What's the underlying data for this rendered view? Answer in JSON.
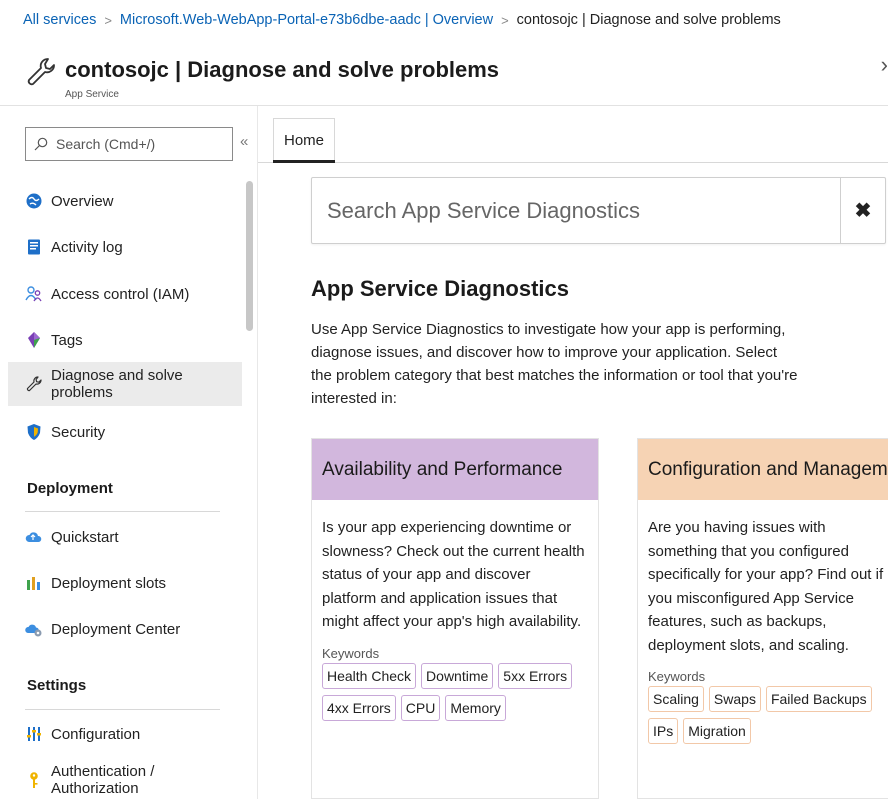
{
  "breadcrumb": {
    "items": [
      "All services",
      "Microsoft.Web-WebApp-Portal-e73b6dbe-aadc | Overview"
    ],
    "current": "contosojc | Diagnose and solve problems"
  },
  "header": {
    "title": "contosojc | Diagnose and solve problems",
    "subtitle": "App Service",
    "close_glyph": "›"
  },
  "sidebar": {
    "search_placeholder": "Search (Cmd+/)",
    "collapse_glyph": "«",
    "items": [
      {
        "label": "Overview",
        "icon": "globe-icon",
        "color": "#1e6fc8"
      },
      {
        "label": "Activity log",
        "icon": "activity-log-icon",
        "color": "#1e6fc8"
      },
      {
        "label": "Access control (IAM)",
        "icon": "people-icon",
        "color": "#3c8ee0"
      },
      {
        "label": "Tags",
        "icon": "tag-icon",
        "color": "#7a3fb5"
      },
      {
        "label": "Diagnose and solve problems",
        "icon": "wrench-icon",
        "color": "#333333"
      },
      {
        "label": "Security",
        "icon": "shield-icon",
        "color": "#1e6fc8"
      }
    ],
    "sections": [
      {
        "title": "Deployment",
        "items": [
          {
            "label": "Quickstart",
            "icon": "cloud-icon",
            "color": "#3c8ee0"
          },
          {
            "label": "Deployment slots",
            "icon": "deployment-slots-icon",
            "color": "#e0a020"
          },
          {
            "label": "Deployment Center",
            "icon": "deployment-center-icon",
            "color": "#3c8ee0"
          }
        ]
      },
      {
        "title": "Settings",
        "items": [
          {
            "label": "Configuration",
            "icon": "configuration-icon",
            "color": "#1e6fc8"
          },
          {
            "label": "Authentication / Authorization",
            "icon": "key-icon",
            "color": "#f0b400"
          }
        ]
      }
    ]
  },
  "main": {
    "tabs": [
      {
        "label": "Home"
      }
    ],
    "search_placeholder": "Search App Service Diagnostics",
    "clear_glyph": "✖",
    "title": "App Service Diagnostics",
    "description": "Use App Service Diagnostics to investigate how your app is performing, diagnose issues, and discover how to improve your application. Select the problem category that best matches the information or tool that you're interested in:",
    "cards": [
      {
        "title": "Availability and Performance",
        "header_color": "#d2b7dd",
        "description": "Is your app experiencing downtime or slowness? Check out the current health status of your app and discover platform and application issues that might affect your app's high availability.",
        "keywords_label": "Keywords",
        "keywords": [
          "Health Check",
          "Downtime",
          "5xx Errors",
          "4xx Errors",
          "CPU",
          "Memory"
        ]
      },
      {
        "title": "Configuration and Management",
        "header_color": "#f6d3b4",
        "description": "Are you having issues with something that you configured specifically for your app? Find out if you misconfigured App Service features, such as backups, deployment slots, and scaling.",
        "keywords_label": "Keywords",
        "keywords": [
          "Scaling",
          "Swaps",
          "Failed Backups",
          "IPs",
          "Migration"
        ]
      }
    ]
  }
}
